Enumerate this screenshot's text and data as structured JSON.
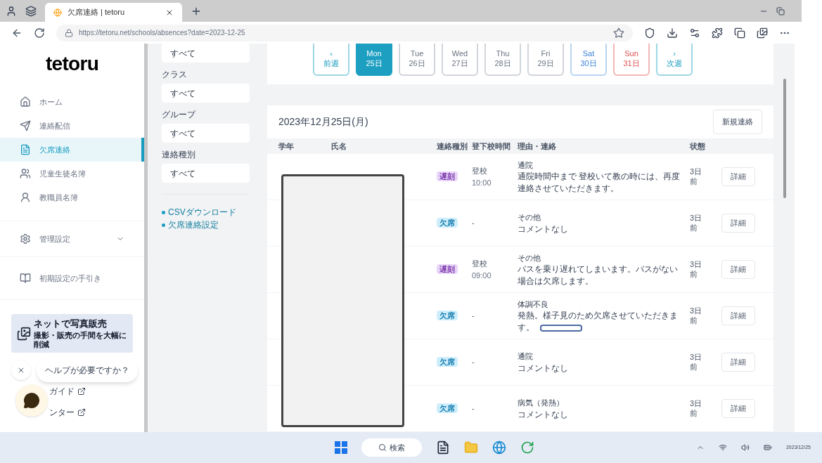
{
  "browser": {
    "tab_title": "欠席連絡 | tetoru",
    "url": "https://tetoru.net/schools/absences?date=2023-12-25"
  },
  "sidebar": {
    "logo": "tetoru",
    "items": [
      {
        "label": "ホーム",
        "selected": false
      },
      {
        "label": "連絡配信",
        "selected": false
      },
      {
        "label": "欠席連絡",
        "selected": true
      },
      {
        "label": "児童生徒名簿",
        "selected": false
      },
      {
        "label": "教職員名簿",
        "selected": false
      }
    ],
    "settings": {
      "label": "管理設定",
      "expanded": false
    },
    "guide": "初期設定の手引き",
    "banner": {
      "title": "ネットで写真販売",
      "subtitle": "撮影・販売の手間を大幅に削減"
    },
    "help_links": [
      "ガイド",
      "ンター"
    ],
    "help_bubble": "ヘルプが必要ですか？"
  },
  "filters": {
    "fields": [
      {
        "value": "すべて"
      },
      {
        "label": "クラス",
        "value": "すべて"
      },
      {
        "label": "グループ",
        "value": "すべて"
      },
      {
        "label": "連絡種別",
        "value": "すべて"
      }
    ],
    "links": [
      "CSVダウンロード",
      "欠席連絡設定"
    ]
  },
  "week": [
    {
      "kind": "nav",
      "top": "‹",
      "bottom": "前週",
      "selected": false
    },
    {
      "kind": "weekday",
      "top": "Mon",
      "bottom": "25日",
      "selected": true
    },
    {
      "kind": "weekday",
      "top": "Tue",
      "bottom": "26日",
      "selected": false
    },
    {
      "kind": "weekday",
      "top": "Wed",
      "bottom": "27日",
      "selected": false
    },
    {
      "kind": "weekday",
      "top": "Thu",
      "bottom": "28日",
      "selected": false
    },
    {
      "kind": "weekday",
      "top": "Fri",
      "bottom": "29日",
      "selected": false
    },
    {
      "kind": "sat",
      "top": "Sat",
      "bottom": "30日",
      "selected": false
    },
    {
      "kind": "sun",
      "top": "Sun",
      "bottom": "31日",
      "selected": false
    },
    {
      "kind": "nav",
      "top": "›",
      "bottom": "次週",
      "selected": false
    }
  ],
  "list": {
    "date": "2023年12月25日(月)",
    "new_button": "新規連絡",
    "columns": [
      "学年",
      "氏名",
      "連絡種別",
      "登下校時間",
      "理由・連絡",
      "状態"
    ],
    "rows": [
      {
        "kind": "late",
        "badge": "遅刻",
        "time": "登校",
        "time2": "10:00",
        "reason": "通院",
        "comment": "通院時間中まで 登校いて教の時には、再度連絡させていただきます。",
        "status": "3日前",
        "action": "詳細"
      },
      {
        "kind": "absent",
        "badge": "欠席",
        "time": "-",
        "reason": "その他",
        "comment": "コメントなし",
        "status": "3日前",
        "action": "詳細"
      },
      {
        "kind": "late",
        "badge": "遅刻",
        "time": "登校",
        "time2": "09:00",
        "reason": "その他",
        "comment": "バスを乗り遅れてしまいます。バスがない場合は欠席します。",
        "status": "3日前",
        "action": "詳細"
      },
      {
        "kind": "absent",
        "badge": "欠席",
        "time": "-",
        "reason": "体調不良",
        "comment": "発熱。様子見のため欠席させていただきます。",
        "redacted": true,
        "status": "3日前",
        "action": "詳細"
      },
      {
        "kind": "absent",
        "badge": "欠席",
        "time": "-",
        "reason": "通院",
        "comment": "コメントなし",
        "status": "3日前",
        "action": "詳細"
      },
      {
        "kind": "absent",
        "badge": "欠席",
        "time": "-",
        "reason": "病気（発熱）",
        "comment": "コメントなし",
        "status": "3日前",
        "action": "詳細"
      }
    ]
  },
  "taskbar": {
    "search": "検索",
    "clock": "2023/12/25"
  }
}
